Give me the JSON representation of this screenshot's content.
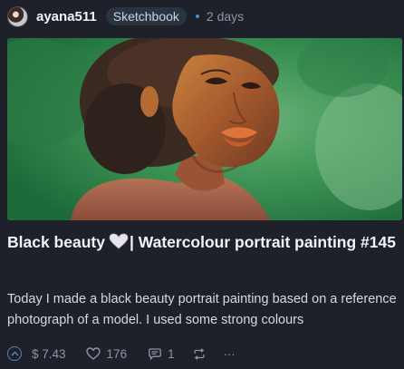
{
  "post": {
    "author": "ayana511",
    "community": "Sketchbook",
    "time_ago": "2 days",
    "title_part1": "Black beauty",
    "title_part2": "| Watercolour portrait painting #145",
    "description": "Today I made a black beauty portrait painting based on a reference photograph of a model. I used some strong colours"
  },
  "footer": {
    "payout": "$ 7.43",
    "votes": "176",
    "comments": "1",
    "more": "···"
  },
  "icons": {
    "avatar": "user-avatar",
    "heart": "white-heart-emoji",
    "upvote": "upvote-chevron-icon",
    "votes": "heart-outline-icon",
    "comments": "comment-bubble-icon",
    "reblog": "reblog-arrows-icon",
    "more": "ellipsis-icon"
  },
  "colors": {
    "background": "#1e2129",
    "accent": "#4e87c2",
    "muted": "#8d95a5",
    "badge_bg": "#2a3441"
  }
}
